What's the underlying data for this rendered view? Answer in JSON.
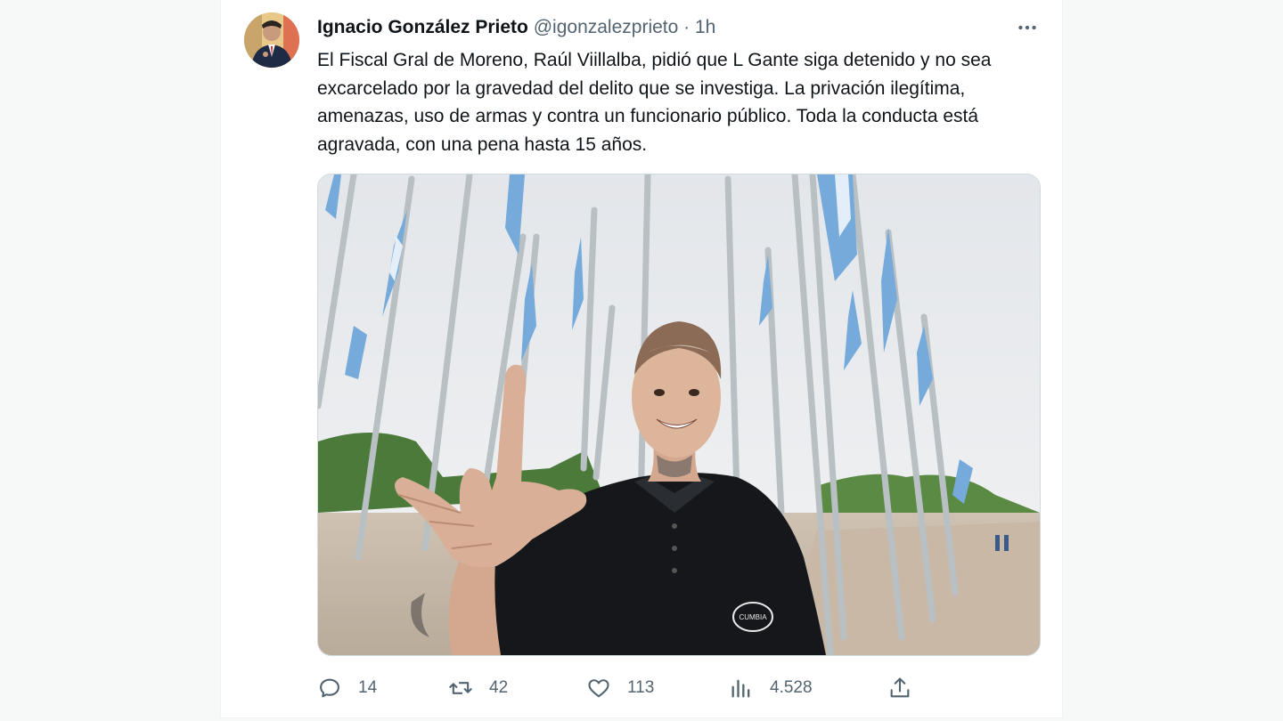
{
  "tweet": {
    "author_name": "Ignacio González Prieto",
    "author_handle": "@igonzalezprieto",
    "separator": "·",
    "time": "1h",
    "text": "El Fiscal Gral de Moreno, Raúl Viillalba, pidió que L Gante siga detenido y no sea excarcelado por la gravedad del delito que se investiga. La privación ilegítima, amenazas, uso de armas y contra un funcionario público. Toda la conducta está agravada, con una pena hasta 15 años.",
    "media_badge_text": "CUMBIA"
  },
  "actions": {
    "reply_count": "14",
    "retweet_count": "42",
    "like_count": "113",
    "views_count": "4.528"
  },
  "icons": {
    "more": "more-horizontal-icon",
    "reply": "reply-icon",
    "retweet": "retweet-icon",
    "like": "heart-icon",
    "views": "views-icon",
    "share": "share-icon"
  },
  "colors": {
    "text_primary": "#0f1419",
    "text_secondary": "#536471",
    "flag_blue": "#75aadb"
  }
}
